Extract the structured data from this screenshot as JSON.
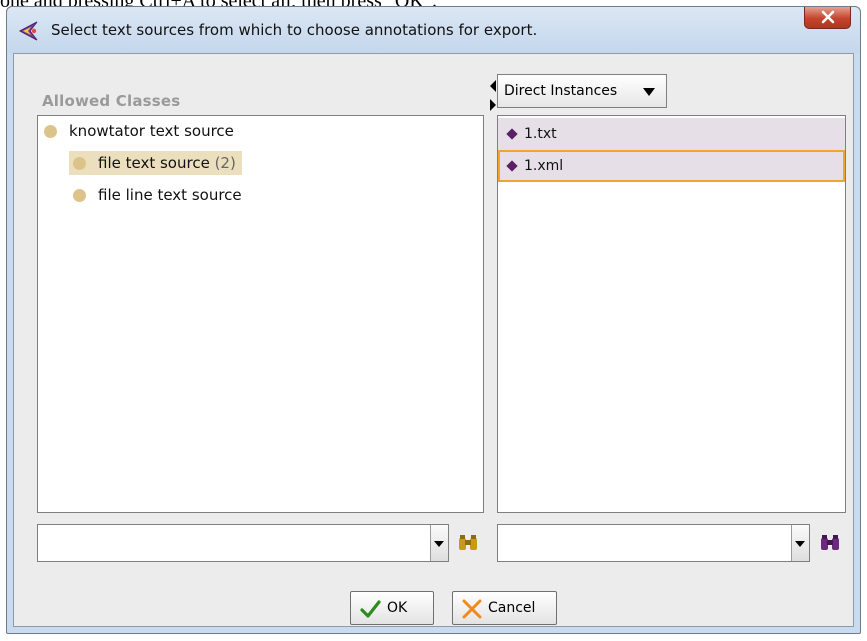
{
  "background_caption": "one and pressing Ctrl+A to select all, then press \"OK\".",
  "window": {
    "title": "Select text sources from which to choose annotations for export.",
    "close_label": "X"
  },
  "left_panel": {
    "label": "Allowed Classes",
    "tree": [
      {
        "label": "knowtator text source",
        "count": ""
      },
      {
        "label": "file text source",
        "count": "(2)"
      },
      {
        "label": "file line text source",
        "count": ""
      }
    ],
    "search_value": ""
  },
  "right_panel": {
    "view_dropdown": "Direct Instances",
    "instances": [
      {
        "label": "1.txt"
      },
      {
        "label": "1.xml"
      }
    ],
    "search_value": ""
  },
  "buttons": {
    "ok": "OK",
    "cancel": "Cancel"
  },
  "colors": {
    "class_dot": "#dcc38a",
    "selected_class_bg": "#ecdfbd",
    "instance_diamond": "#5a1f66",
    "focus_border": "#f0a52c",
    "close_button": "#c4442c"
  }
}
